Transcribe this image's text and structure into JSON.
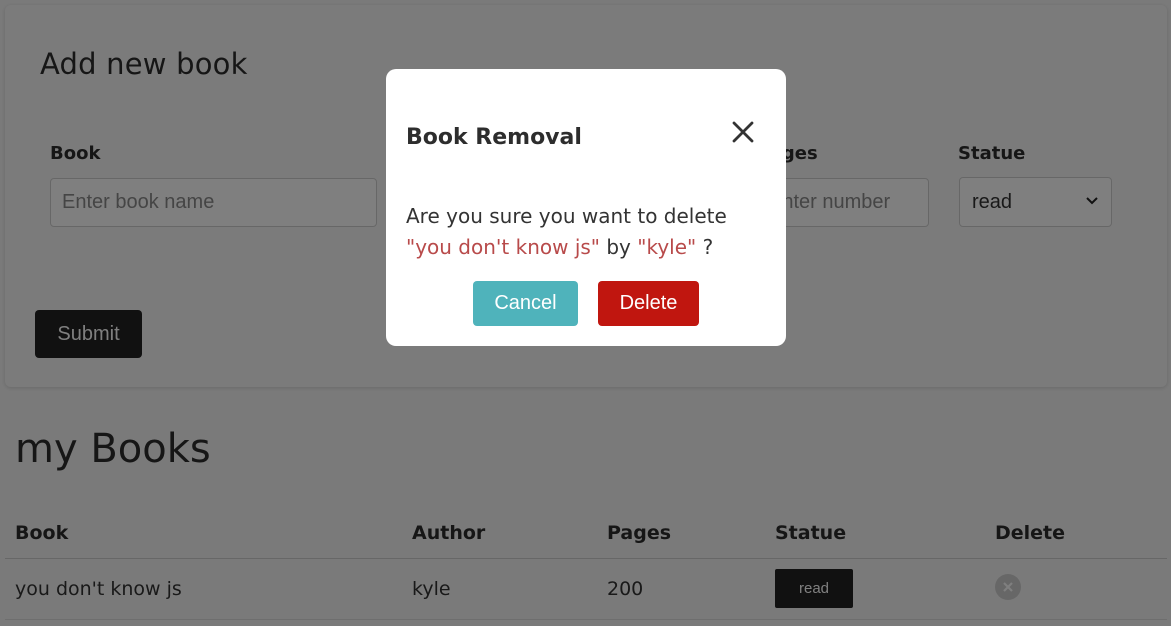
{
  "form": {
    "title": "Add new book",
    "book_label": "Book",
    "book_placeholder": "Enter book name",
    "pages_label": "Pages",
    "pages_placeholder": "Enter number",
    "status_label": "Statue",
    "status_value": "read",
    "submit_label": "Submit"
  },
  "books": {
    "title": "my Books",
    "headers": [
      "Book",
      "Author",
      "Pages",
      "Statue",
      "Delete"
    ],
    "rows": [
      {
        "book": "you don't know js",
        "author": "kyle",
        "pages": "200",
        "status": "read"
      }
    ]
  },
  "modal": {
    "title": "Book Removal",
    "msg_prefix": "Are you sure you want to delete",
    "book_quoted": "\"you don't know js\"",
    "msg_by": "by",
    "author_quoted": "\"kyle\"",
    "msg_suffix": "?",
    "cancel_label": "Cancel",
    "delete_label": "Delete"
  },
  "colors": {
    "cancel": "#4fb3bb",
    "delete": "#c0160f",
    "quote_text": "#b84a4a",
    "dark": "#222222"
  },
  "icons": {
    "close": "close-icon",
    "row_delete": "x-circle-icon",
    "select_arrow": "chevron-down-icon"
  }
}
